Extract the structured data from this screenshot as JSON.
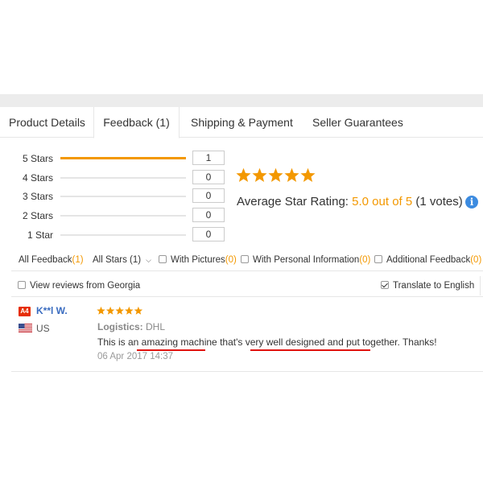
{
  "tabs": [
    {
      "label": "Product Details",
      "active": false
    },
    {
      "label": "Feedback (1)",
      "active": true
    },
    {
      "label": "Shipping & Payment",
      "active": false
    },
    {
      "label": "Seller Guarantees",
      "active": false
    }
  ],
  "rating_breakdown": [
    {
      "label": "5 Stars",
      "count": "1",
      "fill": 1.0
    },
    {
      "label": "4 Stars",
      "count": "0",
      "fill": 0
    },
    {
      "label": "3 Stars",
      "count": "0",
      "fill": 0
    },
    {
      "label": "2 Stars",
      "count": "0",
      "fill": 0
    },
    {
      "label": "1 Star",
      "count": "0",
      "fill": 0
    }
  ],
  "summary": {
    "stars": 5,
    "avg_label": "Average Star Rating:",
    "avg_score": "5.0 out of 5",
    "votes": "(1 votes)",
    "info_icon": "info-icon"
  },
  "filters": {
    "all_feedback": "All Feedback",
    "all_feedback_count": "(1)",
    "all_stars": "All Stars (1)",
    "with_pictures": "With Pictures",
    "with_pictures_count": "(0)",
    "with_personal": "With Personal Information",
    "with_personal_count": "(0)",
    "additional": "Additional Feedback",
    "additional_count": "(0)"
  },
  "view": {
    "view_reviews": "View reviews from Georgia",
    "view_checked": false,
    "translate": "Translate to English",
    "translate_checked": true
  },
  "review": {
    "badge": "A4",
    "user": "K**l W.",
    "country": "US",
    "stars": 5,
    "logistics_label": "Logistics:",
    "logistics_value": "DHL",
    "text": "This is an amazing machine that's very well designed and put together. Thanks!",
    "date": "06 Apr 2017 14:37"
  },
  "colors": {
    "accent": "#f39800",
    "link": "#3a6cc0",
    "badge": "#e62e04",
    "underline": "#e0120e"
  }
}
